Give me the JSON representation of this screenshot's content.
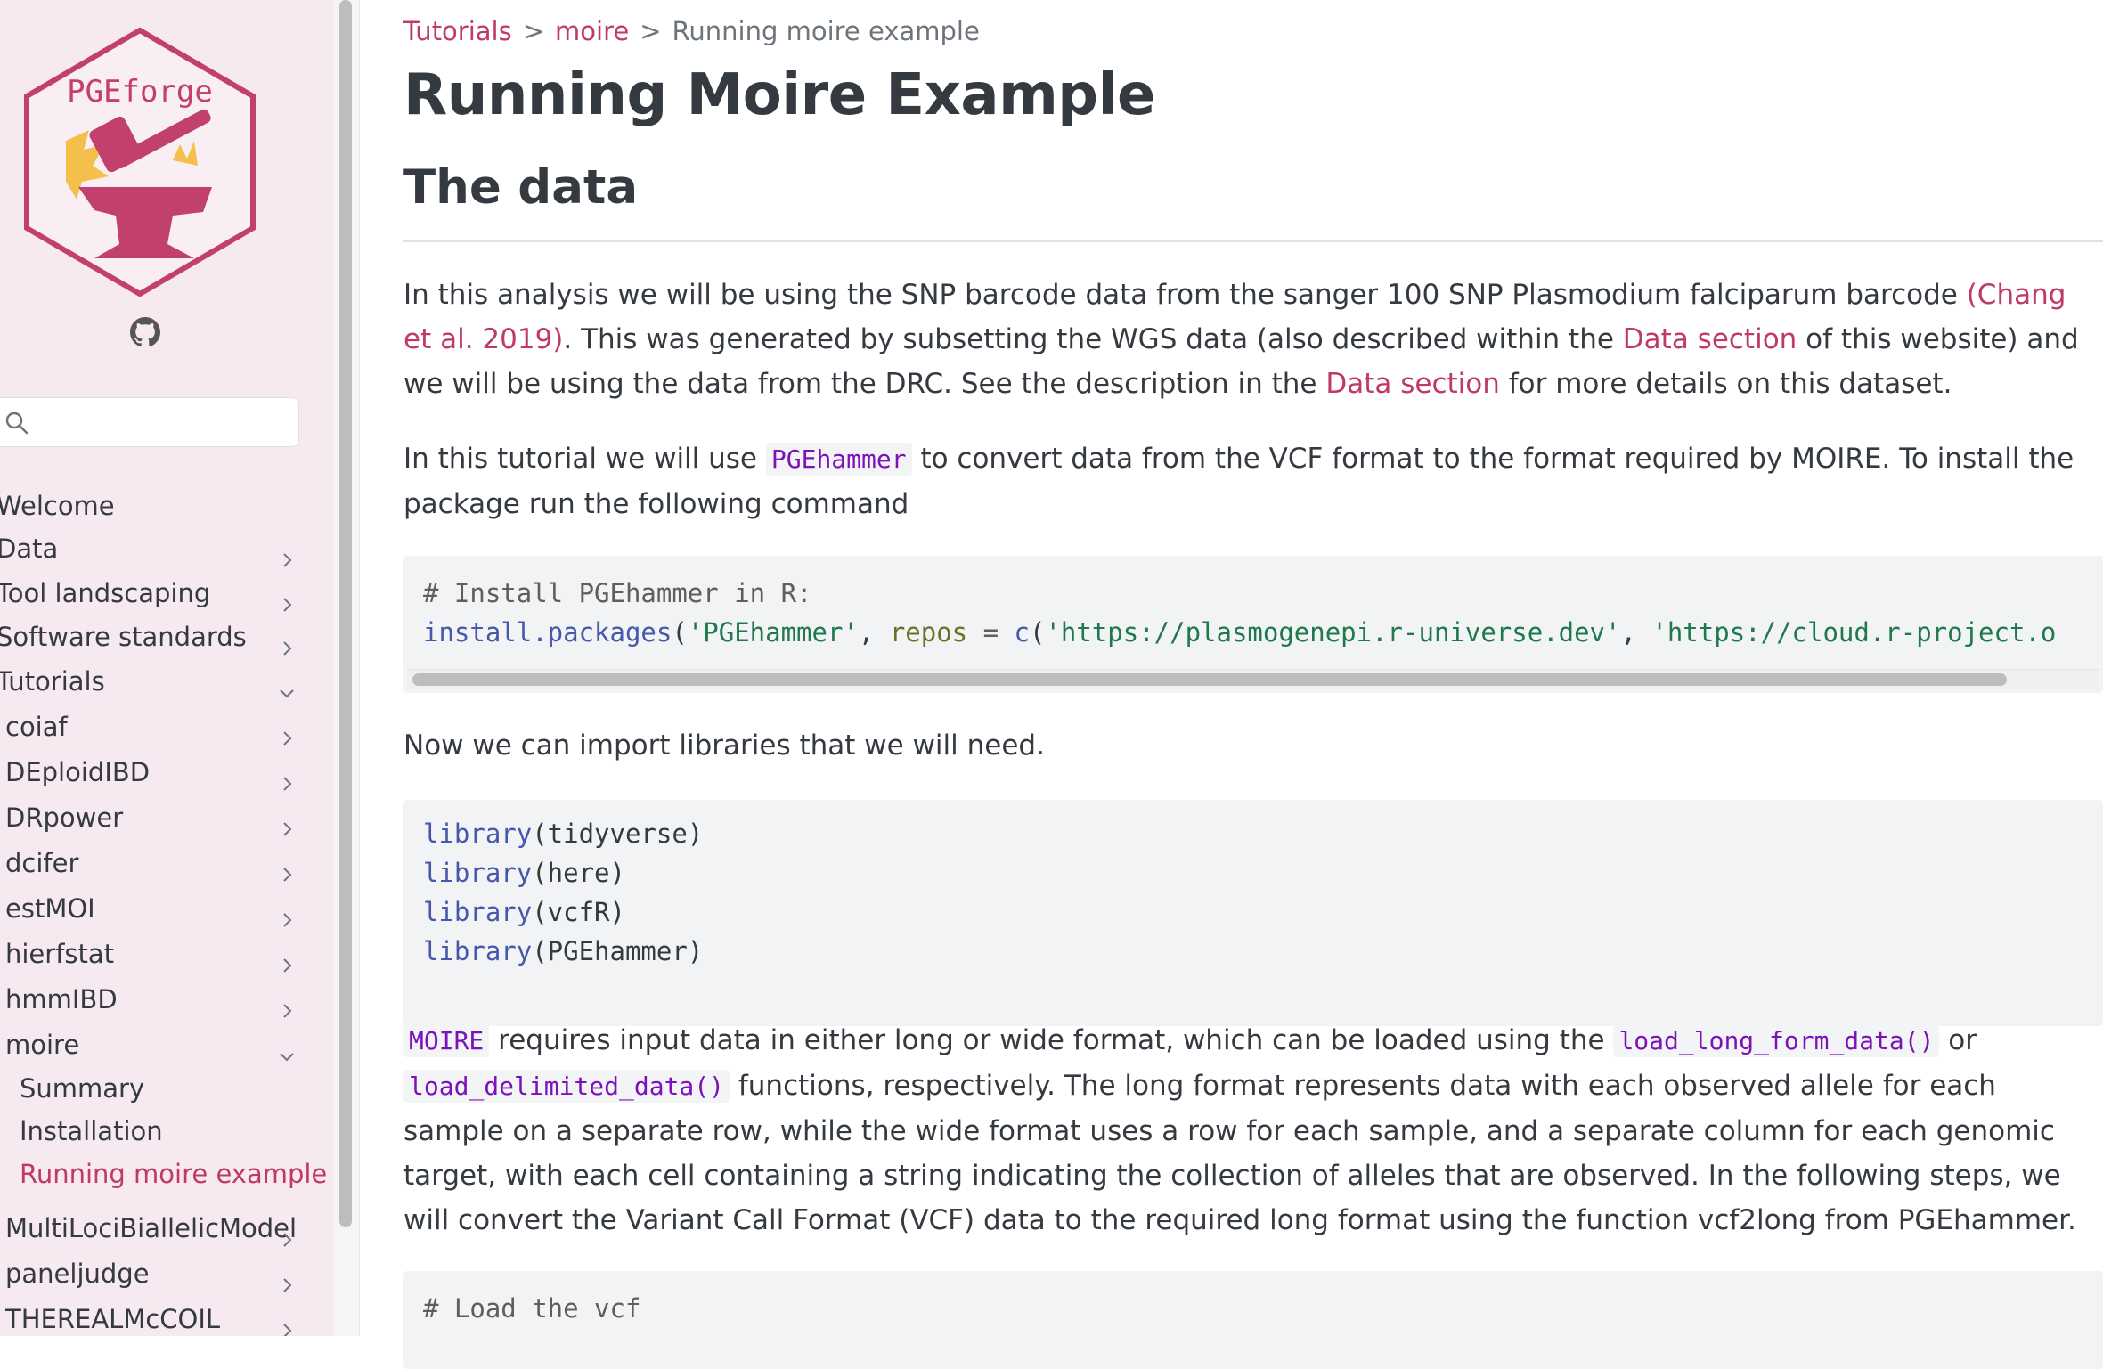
{
  "sidebar": {
    "logo_text": "PGEforge",
    "search_placeholder": "",
    "items": [
      {
        "label": "Welcome",
        "chevron": "none",
        "level": 0,
        "active": false
      },
      {
        "label": "Data",
        "chevron": "right",
        "level": 0,
        "active": false
      },
      {
        "label": "Tool landscaping",
        "chevron": "right",
        "level": 0,
        "active": false
      },
      {
        "label": "Software standards",
        "chevron": "right",
        "level": 0,
        "active": false
      },
      {
        "label": "Tutorials",
        "chevron": "down",
        "level": 0,
        "active": false
      },
      {
        "label": "coiaf",
        "chevron": "right",
        "level": 1,
        "active": false
      },
      {
        "label": "DEploidIBD",
        "chevron": "right",
        "level": 1,
        "active": false
      },
      {
        "label": "DRpower",
        "chevron": "right",
        "level": 1,
        "active": false
      },
      {
        "label": "dcifer",
        "chevron": "right",
        "level": 1,
        "active": false
      },
      {
        "label": "estMOI",
        "chevron": "right",
        "level": 1,
        "active": false
      },
      {
        "label": "hierfstat",
        "chevron": "right",
        "level": 1,
        "active": false
      },
      {
        "label": "hmmIBD",
        "chevron": "right",
        "level": 1,
        "active": false
      },
      {
        "label": "moire",
        "chevron": "down",
        "level": 1,
        "active": false
      },
      {
        "label": "Summary",
        "chevron": "none",
        "level": 2,
        "active": false
      },
      {
        "label": "Installation",
        "chevron": "none",
        "level": 2,
        "active": false
      },
      {
        "label": "Running moire example",
        "chevron": "none",
        "level": 2,
        "active": true
      },
      {
        "label": "MultiLociBiallelicModel",
        "chevron": "right",
        "level": 1,
        "active": false
      },
      {
        "label": "paneljudge",
        "chevron": "right",
        "level": 1,
        "active": false
      },
      {
        "label": "THEREALMcCOIL",
        "chevron": "right",
        "level": 1,
        "active": false
      }
    ]
  },
  "breadcrumb": {
    "items": [
      "Tutorials",
      "moire",
      "Running moire example"
    ],
    "separator": ">"
  },
  "page": {
    "title": "Running Moire Example",
    "section_heading": "The data",
    "p1": {
      "t1": "In this analysis we will be using the SNP barcode data from the sanger 100 SNP Plasmodium falciparum barcode ",
      "l1": "(Chang et al. 2019)",
      "t2": ". This was generated by subsetting the WGS data (also described within the ",
      "l2": "Data section",
      "t3": " of this website) and we will be using the data from the DRC. See the description in the ",
      "l3": "Data section",
      "t4": " for more details on this dataset."
    },
    "p2": {
      "t1": "In this tutorial we will use ",
      "c1": "PGEhammer",
      "t2": " to convert data from the VCF format to the format required by MOIRE. To install the package run the following command"
    },
    "code1": {
      "comment": "# Install PGEhammer in R:",
      "fn": "install.packages",
      "open": "(",
      "s1": "'PGEhammer'",
      "comma1": ", ",
      "arg": "repos",
      "eq": " = ",
      "fn2": "c",
      "open2": "(",
      "s2": "'https://plasmogenepi.r-universe.dev'",
      "comma2": ", ",
      "s3": "'https://cloud.r-project.o"
    },
    "p3": "Now we can import libraries that we will need.",
    "code2": {
      "fn": "library",
      "lines": [
        "(tidyverse)",
        "(here)",
        "(vcfR)",
        "(PGEhammer)"
      ]
    },
    "p4": {
      "c1": "MOIRE",
      "t1": " requires input data in either long or wide format, which can be loaded using the ",
      "c2": "load_long_form_data()",
      "t2": " or ",
      "c3": "load_delimited_data()",
      "t3": " functions, respectively. The long format represents data with each observed allele for each sample on a separate row, while the wide format uses a row for each sample, and a separate column for each genomic target, with each cell containing a string indicating the collection of alleles that are observed. In the following steps, we will convert the Variant Call Format (VCF) data to the required long format using the function vcf2long from PGEhammer."
    },
    "code3": {
      "comment": "# Load the vcf"
    }
  },
  "colors": {
    "accent": "#c03a67",
    "sidebar_bg": "#f6e9ef",
    "code_bg": "#f1f3f5",
    "inline_code": "#7d12ba"
  }
}
